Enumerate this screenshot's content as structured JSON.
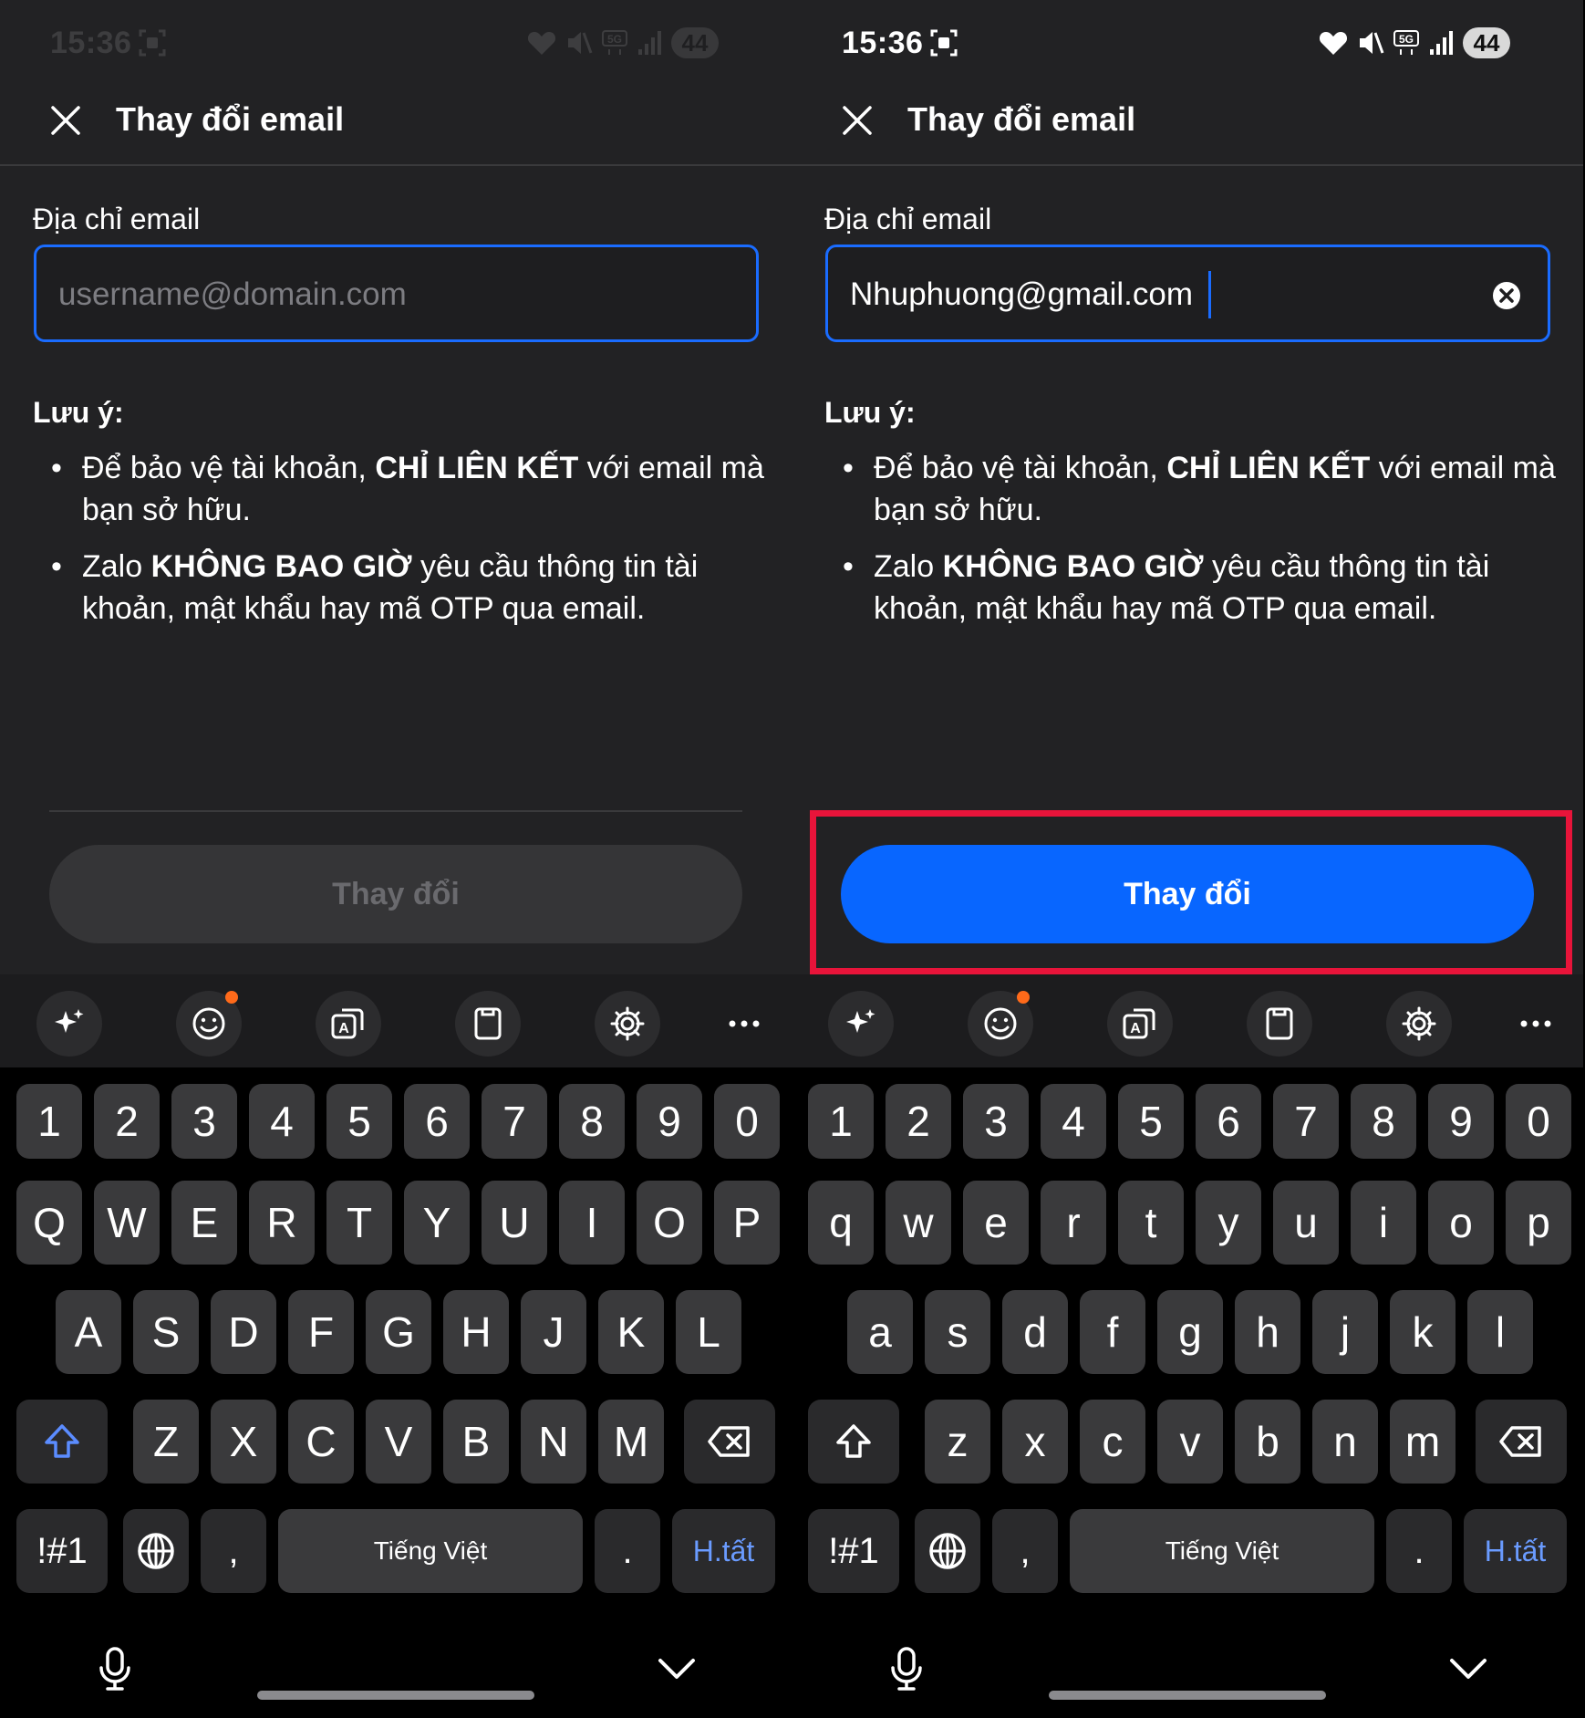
{
  "status": {
    "time": "15:36",
    "battery": "44",
    "network": "5G"
  },
  "header": {
    "title": "Thay đổi email"
  },
  "form": {
    "label": "Địa chỉ email",
    "placeholder": "username@domain.com",
    "value_filled": "Nhuphuong@gmail.com"
  },
  "notes": {
    "title": "Lưu ý:",
    "bullet": "•",
    "item1": {
      "pre": "Để bảo vệ tài khoản, ",
      "bold": "CHỈ LIÊN KẾT",
      "post": " với email mà bạn sở hữu."
    },
    "item2": {
      "pre": "Zalo ",
      "bold": "KHÔNG BAO GIỜ",
      "post": " yêu cầu thông tin tài khoản, mật khẩu hay mã OTP qua email."
    }
  },
  "submit": {
    "label": "Thay đổi",
    "left_state": "disabled",
    "right_state": "enabled"
  },
  "keyboard": {
    "numbers": [
      "1",
      "2",
      "3",
      "4",
      "5",
      "6",
      "7",
      "8",
      "9",
      "0"
    ],
    "row1_upper": [
      "Q",
      "W",
      "E",
      "R",
      "T",
      "Y",
      "U",
      "I",
      "O",
      "P"
    ],
    "row2_upper": [
      "A",
      "S",
      "D",
      "F",
      "G",
      "H",
      "J",
      "K",
      "L"
    ],
    "row3_upper": [
      "Z",
      "X",
      "C",
      "V",
      "B",
      "N",
      "M"
    ],
    "row1_lower": [
      "q",
      "w",
      "e",
      "r",
      "t",
      "y",
      "u",
      "i",
      "o",
      "p"
    ],
    "row2_lower": [
      "a",
      "s",
      "d",
      "f",
      "g",
      "h",
      "j",
      "k",
      "l"
    ],
    "row3_lower": [
      "z",
      "x",
      "c",
      "v",
      "b",
      "n",
      "m"
    ],
    "symbols": "!#1",
    "comma": ",",
    "space": "Tiếng Việt",
    "period": ".",
    "done": "H.tất"
  },
  "colors": {
    "accent": "#0866ff",
    "highlight": "#e8143a",
    "handle": "#0b8a79",
    "badge": "#ff6a1a"
  }
}
